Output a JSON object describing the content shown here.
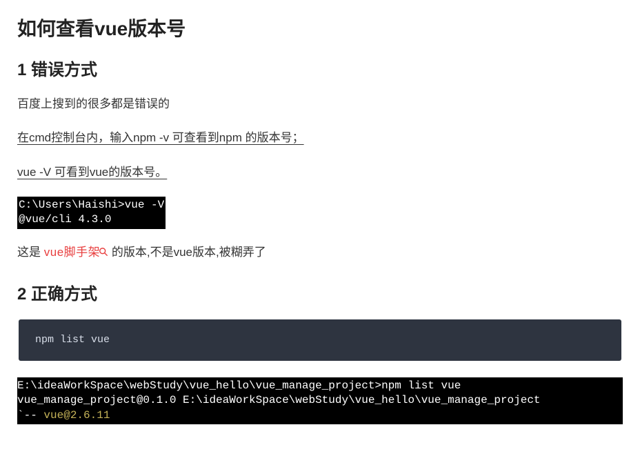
{
  "title": "如何查看vue版本号",
  "section1": {
    "heading": "1 错误方式",
    "intro": "百度上搜到的很多都是错误的",
    "step1": "在cmd控制台内，输入npm -v 可查看到npm 的版本号；",
    "step2": "vue -V 可看到vue的版本号。",
    "terminal": "C:\\Users\\Haishi>vue -V\n@vue/cli 4.3.0",
    "note_prefix": "这是 ",
    "note_link": "vue脚手架",
    "note_suffix": " 的版本,不是vue版本,被糊弄了"
  },
  "section2": {
    "heading": "2 正确方式",
    "command": "npm list vue",
    "terminal_line1": "E:\\ideaWorkSpace\\webStudy\\vue_hello\\vue_manage_project>npm list vue",
    "terminal_line2": "vue_manage_project@0.1.0 E:\\ideaWorkSpace\\webStudy\\vue_hello\\vue_manage_project",
    "terminal_line3_prefix": "`-- ",
    "terminal_line3_result": "vue@2.6.11"
  }
}
